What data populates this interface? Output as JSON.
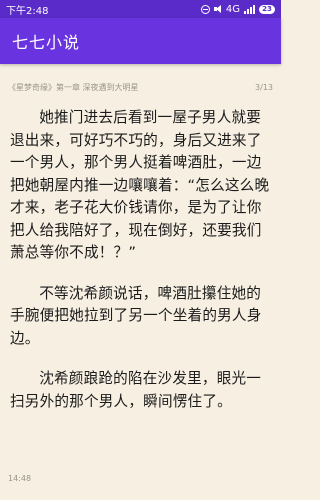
{
  "status_bar": {
    "time": "下午2:48",
    "network": "4G",
    "battery": "23"
  },
  "app": {
    "title": "七七小说"
  },
  "reader": {
    "chapter_title": "《星梦奇缘》第一章 深夜遇到大明星",
    "page_indicator": "3/13",
    "paragraphs": [
      "她推门进去后看到一屋子男人就要退出来，可好巧不巧的，身后又进来了一个男人，那个男人挺着啤酒肚，一边把她朝屋内推一边嚷嚷着：“怎么这么晚才来，老子花大价钱请你，是为了让你把人给我陪好了，现在倒好，还要我们萧总等你不成！？”",
      "不等沈希颜说话，啤酒肚攥住她的手腕便把她拉到了另一个坐着的男人身边。",
      "沈希颜踉跄的陷在沙发里，眼光一扫另外的那个男人，瞬间愣住了。"
    ],
    "footer_time": "14:48"
  },
  "colors": {
    "status_bar_bg": "#5b2bc9",
    "app_bar_bg": "#6a33e0",
    "page_bg": "#f6efe2",
    "text": "#1b1b1b",
    "meta_text": "#9a9589"
  },
  "icons": [
    "do-not-disturb-icon",
    "volume-icon",
    "signal-icon",
    "battery-icon"
  ]
}
